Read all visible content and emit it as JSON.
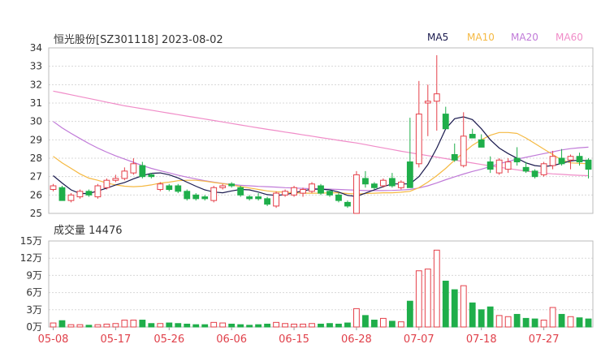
{
  "title": "恒光股份[SZ301118] 2023-08-02",
  "legend": [
    {
      "label": "MA5",
      "color": "#1a1a4e"
    },
    {
      "label": "MA10",
      "color": "#f5b942"
    },
    {
      "label": "MA20",
      "color": "#c07ad8"
    },
    {
      "label": "MA60",
      "color": "#f08cc8"
    }
  ],
  "volume_title": "成交量 14476",
  "colors": {
    "up": "#e5404a",
    "down": "#1fae4a",
    "grid": "#d8d8d8",
    "axis": "#333333",
    "date": "#e0404a"
  },
  "chart_data": [
    {
      "type": "candlestick",
      "ylim": [
        25,
        34
      ],
      "y_ticks": [
        "34",
        "33",
        "32",
        "31",
        "30",
        "29",
        "28",
        "27",
        "26",
        "25"
      ],
      "x_tick_labels": [
        "05-08",
        "05-17",
        "05-26",
        "06-06",
        "06-15",
        "06-28",
        "07-07",
        "07-18",
        "07-27"
      ],
      "x_tick_index": [
        0,
        7,
        13,
        20,
        27,
        34,
        41,
        48,
        55
      ],
      "ohlc": [
        [
          26.3,
          26.6,
          26.2,
          26.5
        ],
        [
          26.4,
          26.5,
          25.7,
          25.7
        ],
        [
          25.7,
          26.1,
          25.6,
          26.0
        ],
        [
          25.9,
          26.3,
          25.8,
          26.2
        ],
        [
          26.2,
          26.3,
          25.9,
          26.0
        ],
        [
          25.9,
          26.6,
          25.8,
          26.5
        ],
        [
          26.4,
          26.9,
          26.3,
          26.8
        ],
        [
          26.8,
          27.1,
          26.7,
          26.9
        ],
        [
          26.9,
          27.5,
          26.8,
          27.3
        ],
        [
          27.2,
          28.0,
          27.1,
          27.7
        ],
        [
          27.6,
          27.8,
          26.9,
          27.0
        ],
        [
          27.1,
          27.2,
          26.9,
          27.0
        ],
        [
          26.3,
          26.7,
          26.2,
          26.6
        ],
        [
          26.5,
          26.6,
          26.2,
          26.3
        ],
        [
          26.5,
          26.6,
          26.1,
          26.2
        ],
        [
          26.2,
          26.3,
          25.7,
          25.8
        ],
        [
          26.0,
          26.1,
          25.7,
          25.8
        ],
        [
          25.9,
          26.0,
          25.7,
          25.8
        ],
        [
          25.7,
          26.5,
          25.6,
          26.4
        ],
        [
          26.4,
          26.6,
          26.3,
          26.5
        ],
        [
          26.6,
          26.7,
          26.4,
          26.5
        ],
        [
          26.4,
          26.5,
          25.9,
          26.0
        ],
        [
          25.9,
          26.0,
          25.7,
          25.8
        ],
        [
          25.9,
          26.1,
          25.7,
          25.8
        ],
        [
          25.8,
          25.9,
          25.4,
          25.5
        ],
        [
          25.4,
          26.2,
          25.3,
          26.1
        ],
        [
          26.0,
          26.3,
          25.9,
          26.2
        ],
        [
          26.0,
          26.5,
          25.9,
          26.4
        ],
        [
          26.1,
          26.4,
          25.9,
          26.3
        ],
        [
          26.2,
          26.7,
          26.1,
          26.6
        ],
        [
          26.5,
          26.6,
          26.0,
          26.1
        ],
        [
          26.2,
          26.3,
          25.9,
          26.0
        ],
        [
          26.0,
          26.1,
          25.6,
          25.7
        ],
        [
          25.6,
          25.7,
          25.3,
          25.4
        ],
        [
          25.0,
          27.3,
          25.0,
          27.1
        ],
        [
          26.9,
          27.3,
          26.4,
          26.6
        ],
        [
          26.6,
          26.7,
          26.3,
          26.4
        ],
        [
          26.5,
          26.9,
          26.4,
          26.8
        ],
        [
          26.9,
          27.2,
          26.4,
          26.5
        ],
        [
          26.4,
          26.8,
          26.3,
          26.7
        ],
        [
          27.8,
          30.2,
          26.6,
          26.4
        ],
        [
          27.7,
          32.2,
          27.5,
          30.4
        ],
        [
          31.0,
          32.0,
          29.2,
          31.1
        ],
        [
          31.1,
          33.6,
          29.5,
          31.5
        ],
        [
          30.4,
          30.8,
          29.6,
          29.6
        ],
        [
          28.2,
          28.8,
          27.8,
          27.9
        ],
        [
          27.6,
          30.5,
          27.5,
          29.2
        ],
        [
          29.3,
          29.6,
          29.1,
          29.1
        ],
        [
          29.0,
          29.3,
          28.6,
          28.6
        ],
        [
          27.8,
          28.1,
          27.2,
          27.4
        ],
        [
          27.2,
          28.0,
          27.1,
          27.9
        ],
        [
          27.4,
          28.0,
          27.2,
          27.8
        ],
        [
          28.0,
          28.6,
          27.6,
          27.8
        ],
        [
          27.5,
          27.8,
          27.2,
          27.3
        ],
        [
          27.3,
          27.4,
          26.9,
          27.0
        ],
        [
          27.1,
          27.8,
          27.0,
          27.7
        ],
        [
          27.6,
          28.4,
          27.4,
          28.1
        ],
        [
          28.0,
          28.5,
          27.6,
          27.7
        ],
        [
          27.9,
          28.2,
          27.4,
          28.1
        ],
        [
          28.1,
          28.3,
          27.6,
          27.8
        ],
        [
          27.9,
          28.0,
          26.9,
          27.4
        ]
      ],
      "ma5": [
        27.05,
        26.65,
        26.28,
        26.08,
        26.08,
        26.22,
        26.37,
        26.55,
        26.68,
        26.88,
        27.05,
        27.18,
        27.2,
        27.1,
        26.93,
        26.7,
        26.48,
        26.28,
        26.16,
        26.12,
        26.22,
        26.3,
        26.28,
        26.16,
        26.02,
        25.98,
        26.02,
        26.12,
        26.22,
        26.32,
        26.32,
        26.28,
        26.16,
        25.98,
        25.92,
        26.1,
        26.28,
        26.45,
        26.6,
        26.6,
        26.6,
        27.0,
        27.65,
        28.55,
        29.6,
        30.15,
        30.25,
        30.1,
        29.6,
        29.0,
        28.55,
        28.25,
        28.0,
        27.75,
        27.6,
        27.55,
        27.6,
        27.72,
        27.85,
        27.9,
        27.85
      ],
      "ma10": [
        28.1,
        27.75,
        27.45,
        27.15,
        26.92,
        26.8,
        26.65,
        26.55,
        26.48,
        26.45,
        26.48,
        26.55,
        26.65,
        26.7,
        26.78,
        26.8,
        26.8,
        26.75,
        26.68,
        26.62,
        26.55,
        26.46,
        26.38,
        26.3,
        26.22,
        26.18,
        26.15,
        26.12,
        26.1,
        26.1,
        26.1,
        26.12,
        26.12,
        26.08,
        26.05,
        26.08,
        26.1,
        26.12,
        26.12,
        26.15,
        26.2,
        26.4,
        26.7,
        27.05,
        27.45,
        27.9,
        28.3,
        28.7,
        29.0,
        29.25,
        29.4,
        29.4,
        29.35,
        29.1,
        28.8,
        28.5,
        28.2,
        27.9,
        27.75,
        27.72,
        27.7
      ],
      "ma20": [
        30.0,
        29.65,
        29.35,
        29.07,
        28.8,
        28.55,
        28.33,
        28.13,
        27.95,
        27.78,
        27.6,
        27.45,
        27.32,
        27.2,
        27.08,
        26.97,
        26.87,
        26.78,
        26.7,
        26.63,
        26.57,
        26.53,
        26.5,
        26.47,
        26.45,
        26.43,
        26.4,
        26.38,
        26.36,
        26.34,
        26.33,
        26.32,
        26.3,
        26.28,
        26.26,
        26.24,
        26.24,
        26.24,
        26.25,
        26.27,
        26.3,
        26.38,
        26.5,
        26.66,
        26.83,
        26.99,
        27.14,
        27.28,
        27.4,
        27.55,
        27.7,
        27.83,
        27.95,
        28.05,
        28.15,
        28.25,
        28.35,
        28.45,
        28.52,
        28.57,
        28.6
      ],
      "ma60": [
        31.65,
        31.55,
        31.45,
        31.35,
        31.25,
        31.15,
        31.05,
        30.95,
        30.85,
        30.77,
        30.69,
        30.61,
        30.53,
        30.45,
        30.37,
        30.29,
        30.21,
        30.13,
        30.05,
        29.97,
        29.89,
        29.81,
        29.73,
        29.65,
        29.57,
        29.5,
        29.42,
        29.35,
        29.27,
        29.2,
        29.12,
        29.05,
        28.97,
        28.9,
        28.83,
        28.74,
        28.65,
        28.56,
        28.47,
        28.38,
        28.3,
        28.22,
        28.14,
        28.06,
        27.98,
        27.9,
        27.82,
        27.74,
        27.66,
        27.58,
        27.51,
        27.44,
        27.37,
        27.3,
        27.24,
        27.19,
        27.15,
        27.12,
        27.09,
        27.07,
        27.05
      ]
    },
    {
      "type": "bar",
      "title": "成交量 14476",
      "ylim": [
        0,
        150000
      ],
      "y_ticks": [
        "15万",
        "12万",
        "9万",
        "6万",
        "3万",
        "0万"
      ],
      "values": [
        7000,
        11000,
        4000,
        4000,
        3000,
        4000,
        5000,
        6000,
        12000,
        12000,
        12000,
        6000,
        6000,
        7000,
        6000,
        5000,
        4000,
        4000,
        8000,
        7000,
        5000,
        4000,
        3000,
        4000,
        5000,
        8000,
        6000,
        5000,
        5000,
        6000,
        5000,
        6000,
        5000,
        7000,
        32000,
        20000,
        12000,
        15000,
        10000,
        9000,
        45000,
        98000,
        101000,
        134000,
        80000,
        65000,
        72000,
        42000,
        30000,
        35000,
        20000,
        18000,
        22000,
        15000,
        14000,
        12000,
        34000,
        22000,
        18000,
        16000,
        14000
      ]
    }
  ]
}
